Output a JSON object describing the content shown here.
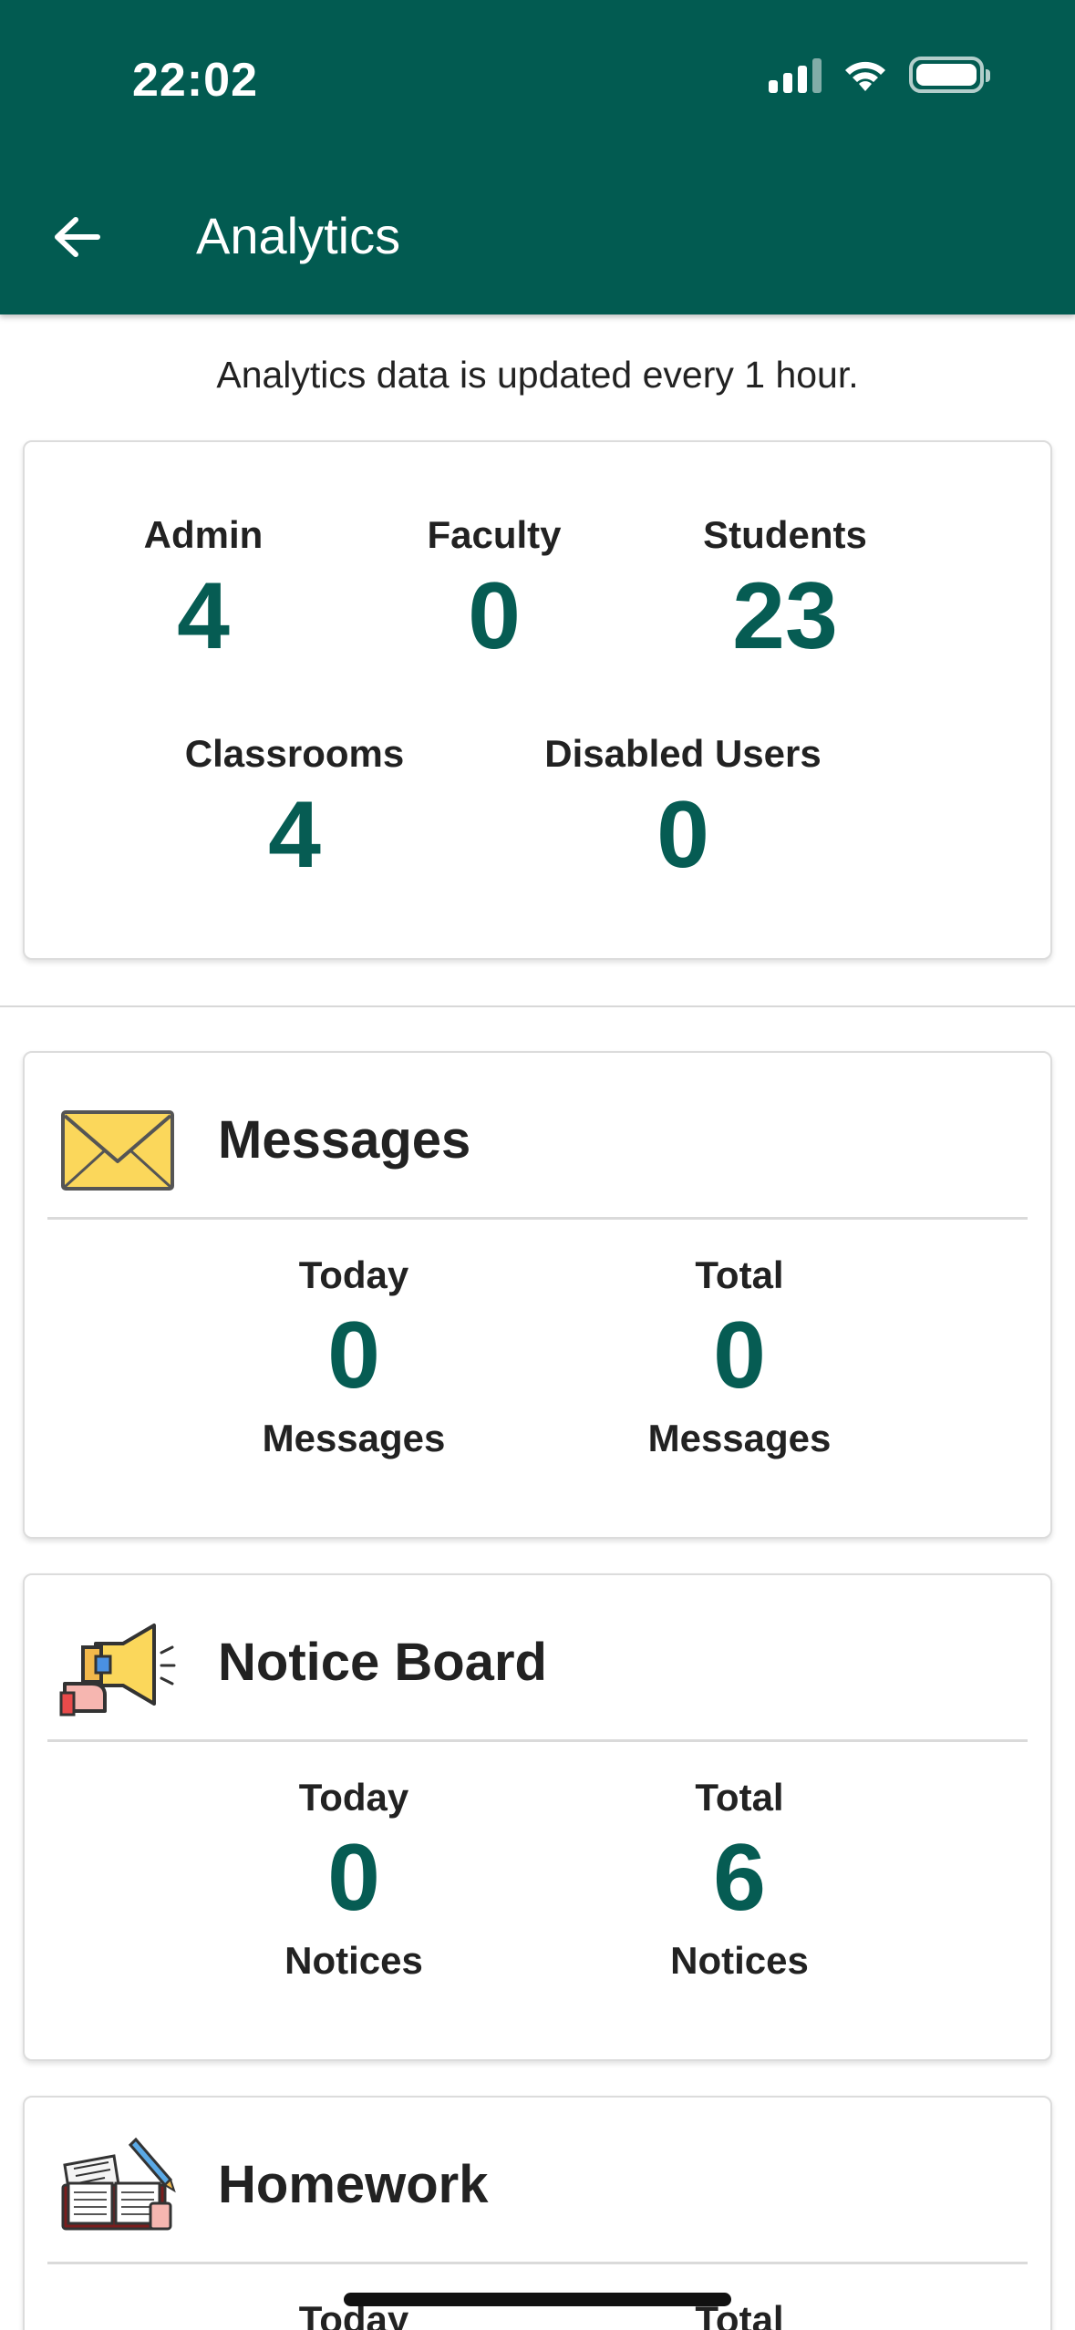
{
  "status_bar": {
    "time": "22:02"
  },
  "header": {
    "title": "Analytics"
  },
  "info": "Analytics data is updated every 1 hour.",
  "summary": {
    "admin": {
      "label": "Admin",
      "value": "4"
    },
    "faculty": {
      "label": "Faculty",
      "value": "0"
    },
    "students": {
      "label": "Students",
      "value": "23"
    },
    "classrooms": {
      "label": "Classrooms",
      "value": "4"
    },
    "disabled": {
      "label": "Disabled Users",
      "value": "0"
    }
  },
  "messages": {
    "title": "Messages",
    "icon": "envelope-icon",
    "today": {
      "label": "Today",
      "value": "0",
      "unit": "Messages"
    },
    "total": {
      "label": "Total",
      "value": "0",
      "unit": "Messages"
    }
  },
  "notice_board": {
    "title": "Notice Board",
    "icon": "megaphone-icon",
    "today": {
      "label": "Today",
      "value": "0",
      "unit": "Notices"
    },
    "total": {
      "label": "Total",
      "value": "6",
      "unit": "Notices"
    }
  },
  "homework": {
    "title": "Homework",
    "icon": "homework-book-icon",
    "today": {
      "label": "Today"
    },
    "total": {
      "label": "Total"
    }
  },
  "colors": {
    "primary": "#025b51",
    "value": "#065c53"
  }
}
